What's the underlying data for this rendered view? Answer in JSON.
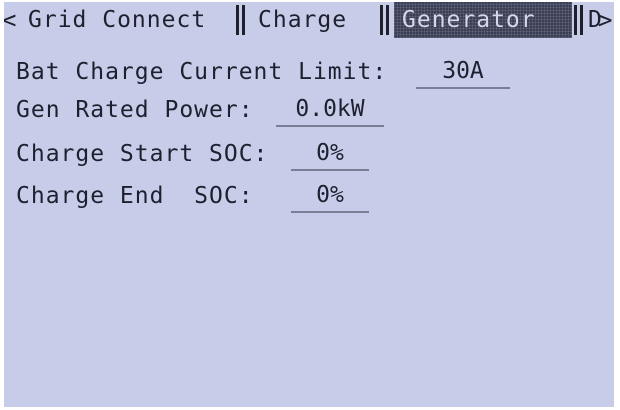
{
  "tabs": {
    "left_arrow": "<",
    "right_arrow": ">",
    "items": [
      {
        "label": "Grid Connect"
      },
      {
        "label": "Charge"
      },
      {
        "label": "Generator"
      },
      {
        "label": "D"
      }
    ]
  },
  "settings": [
    {
      "label": "Bat Charge Current Limit:",
      "value": "30A"
    },
    {
      "label": "Gen Rated Power:",
      "value": "0.0kW"
    },
    {
      "label": "Charge Start SOC:",
      "value": "0%"
    },
    {
      "label": "Charge End  SOC:",
      "value": "0%"
    }
  ]
}
